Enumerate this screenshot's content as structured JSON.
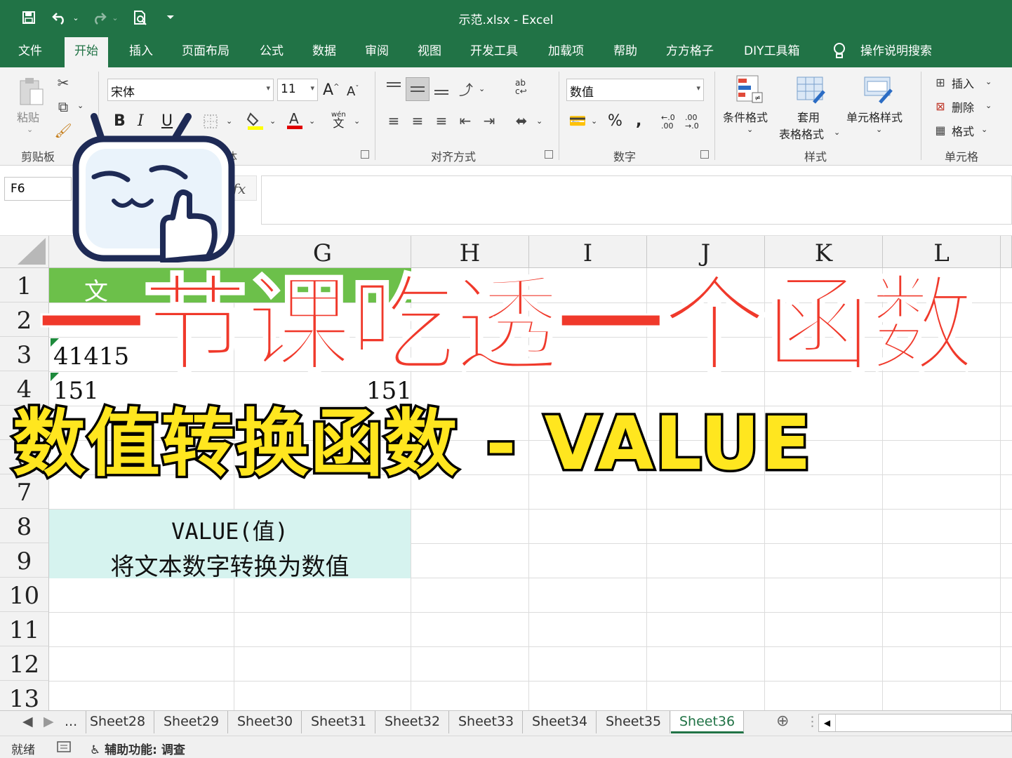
{
  "window": {
    "title": "示范.xlsx  -  Excel"
  },
  "quick_access": {
    "save_icon": "save-icon",
    "undo_icon": "undo-icon",
    "redo_icon": "redo-icon",
    "preview_icon": "print-preview-icon",
    "customize_icon": "customize-icon"
  },
  "ribbon_tabs": [
    "文件",
    "开始",
    "插入",
    "页面布局",
    "公式",
    "数据",
    "审阅",
    "视图",
    "开发工具",
    "加载项",
    "帮助",
    "方方格子",
    "DIY工具箱"
  ],
  "active_tab": "开始",
  "tell_me": "操作说明搜索",
  "clipboard": {
    "paste_label": "粘贴",
    "group_label": "剪贴板"
  },
  "font": {
    "name": "宋体",
    "size": "11",
    "group_label": "字体",
    "phonetic": "wén",
    "phonetic_char": "文"
  },
  "alignment": {
    "group_label": "对齐方式"
  },
  "number": {
    "format": "数值",
    "group_label": "数字"
  },
  "styles": {
    "conditional": "条件格式",
    "table_line1": "套用",
    "table_line2": "表格格式",
    "cell_styles": "单元格样式",
    "group_label": "样式"
  },
  "cells": {
    "insert": "插入",
    "delete": "删除",
    "format": "格式",
    "group_label": "单元格"
  },
  "formula_bar": {
    "name_box": "F6",
    "fx": "fx",
    "content": ""
  },
  "columns": [
    "F",
    "G",
    "H",
    "I",
    "J",
    "K",
    "L"
  ],
  "rows": [
    "1",
    "2",
    "3",
    "4",
    "5",
    "6",
    "7",
    "8",
    "9",
    "10",
    "11",
    "12",
    "13"
  ],
  "cells_data": {
    "f1": "文",
    "f3": "41415",
    "f4": "151",
    "g4": "151"
  },
  "overlay": {
    "headline": "一节课吃透一个函数",
    "subtitle": "数值转换函数 - VALUE"
  },
  "info_box": {
    "line1": "VALUE(值)",
    "line2": "将文本数字转换为数值"
  },
  "sheets": [
    "Sheet28",
    "Sheet29",
    "Sheet30",
    "Sheet31",
    "Sheet32",
    "Sheet33",
    "Sheet34",
    "Sheet35",
    "Sheet36"
  ],
  "active_sheet": "Sheet36",
  "sheet_more": "...",
  "status": {
    "ready": "就绪",
    "accessibility": "辅助功能: 调查"
  },
  "colors": {
    "excel_green": "#217346",
    "headline_red": "#f0392b",
    "subtitle_yellow": "#ffe61f",
    "info_bg": "#d6f3ef",
    "header_fill": "#6cc04a"
  }
}
